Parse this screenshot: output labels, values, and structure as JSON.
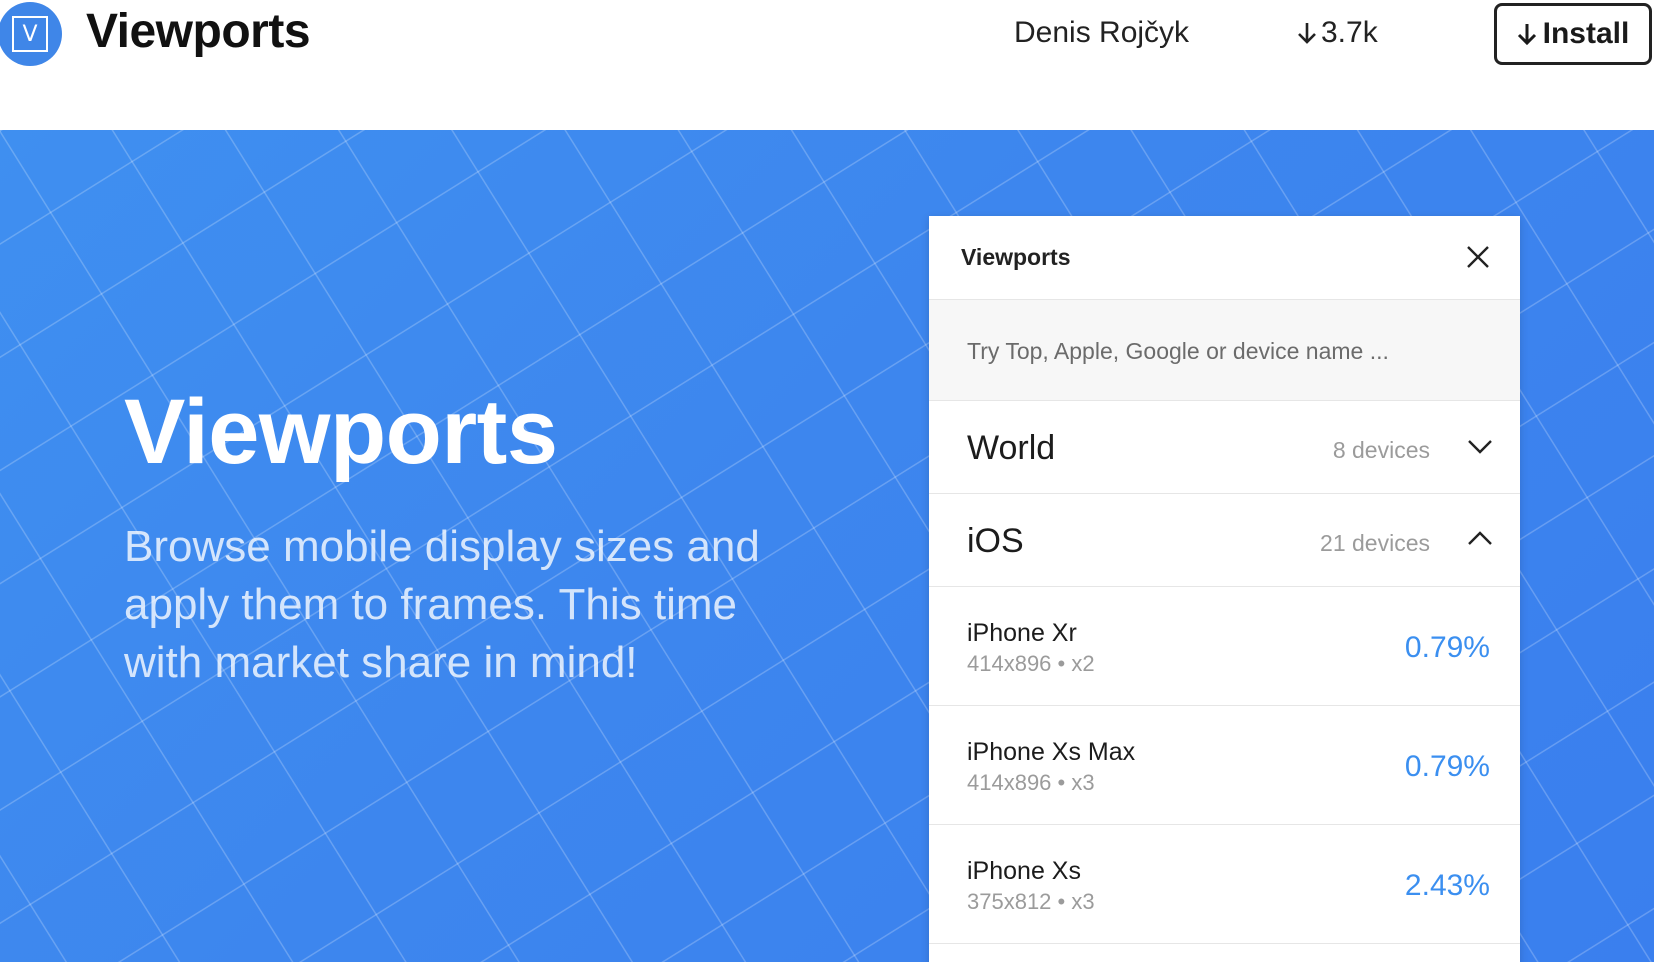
{
  "header": {
    "logo_letter": "V",
    "app_title": "Viewports",
    "author": "Denis Rojčyk",
    "downloads": "3.7k",
    "install_label": "Install"
  },
  "hero": {
    "title": "Viewports",
    "subtitle": "Browse mobile display sizes and apply them to frames. This time with market share in mind!"
  },
  "panel": {
    "title": "Viewports",
    "search_placeholder": "Try Top, Apple, Google or device name ...",
    "groups": [
      {
        "name": "World",
        "count": "8 devices",
        "state": "collapsed",
        "chevron_icon": "chevron-down-icon"
      },
      {
        "name": "iOS",
        "count": "21 devices",
        "state": "expanded",
        "chevron_icon": "chevron-up-icon"
      }
    ],
    "devices": [
      {
        "name": "iPhone Xr",
        "spec": "414x896 • x2",
        "share": "0.79%"
      },
      {
        "name": "iPhone Xs Max",
        "spec": "414x896 • x3",
        "share": "0.79%"
      },
      {
        "name": "iPhone Xs",
        "spec": "375x812 • x3",
        "share": "2.43%"
      }
    ]
  },
  "colors": {
    "hero_blue": "#3d86ee",
    "share_blue": "#3b8ff0",
    "logo_blue": "#3f86e8"
  }
}
